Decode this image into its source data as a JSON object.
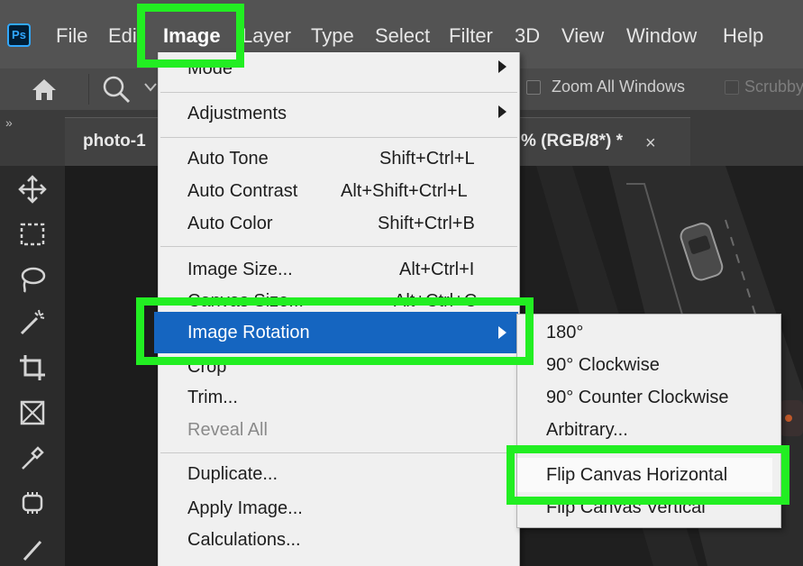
{
  "app": {
    "logo_text": "Ps",
    "accent_green": "#22ee22",
    "highlight_blue": "#1565c0"
  },
  "menubar": {
    "items": [
      "File",
      "Edi",
      "Image",
      "Layer",
      "Type",
      "Select",
      "Filter",
      "3D",
      "View",
      "Window",
      "Help"
    ]
  },
  "options": {
    "zoom_all_windows": "Zoom All Windows",
    "scrubby": "Scrubby"
  },
  "tabs": {
    "left_label": "photo-1",
    "right_label": "% (RGB/8*) *",
    "close_glyph": "×",
    "collapse_glyph": "»"
  },
  "image_menu": {
    "mode": "Mode",
    "adjustments": "Adjustments",
    "auto_tone": "Auto Tone",
    "auto_tone_sc": "Shift+Ctrl+L",
    "auto_contrast": "Auto Contrast",
    "auto_contrast_sc": "Alt+Shift+Ctrl+L",
    "auto_color": "Auto Color",
    "auto_color_sc": "Shift+Ctrl+B",
    "image_size": "Image Size...",
    "image_size_sc": "Alt+Ctrl+I",
    "canvas_size": "Canvas Size...",
    "canvas_size_sc": "Alt+Ctrl+C",
    "image_rotation": "Image Rotation",
    "crop": "Crop",
    "trim": "Trim...",
    "reveal_all": "Reveal All",
    "duplicate": "Duplicate...",
    "apply_image": "Apply Image...",
    "calculations": "Calculations..."
  },
  "rotation_submenu": {
    "r180": "180°",
    "cw": "90° Clockwise",
    "ccw": "90° Counter Clockwise",
    "arbitrary": "Arbitrary...",
    "flip_h": "Flip Canvas Horizontal",
    "flip_v": "Flip Canvas Vertical"
  }
}
